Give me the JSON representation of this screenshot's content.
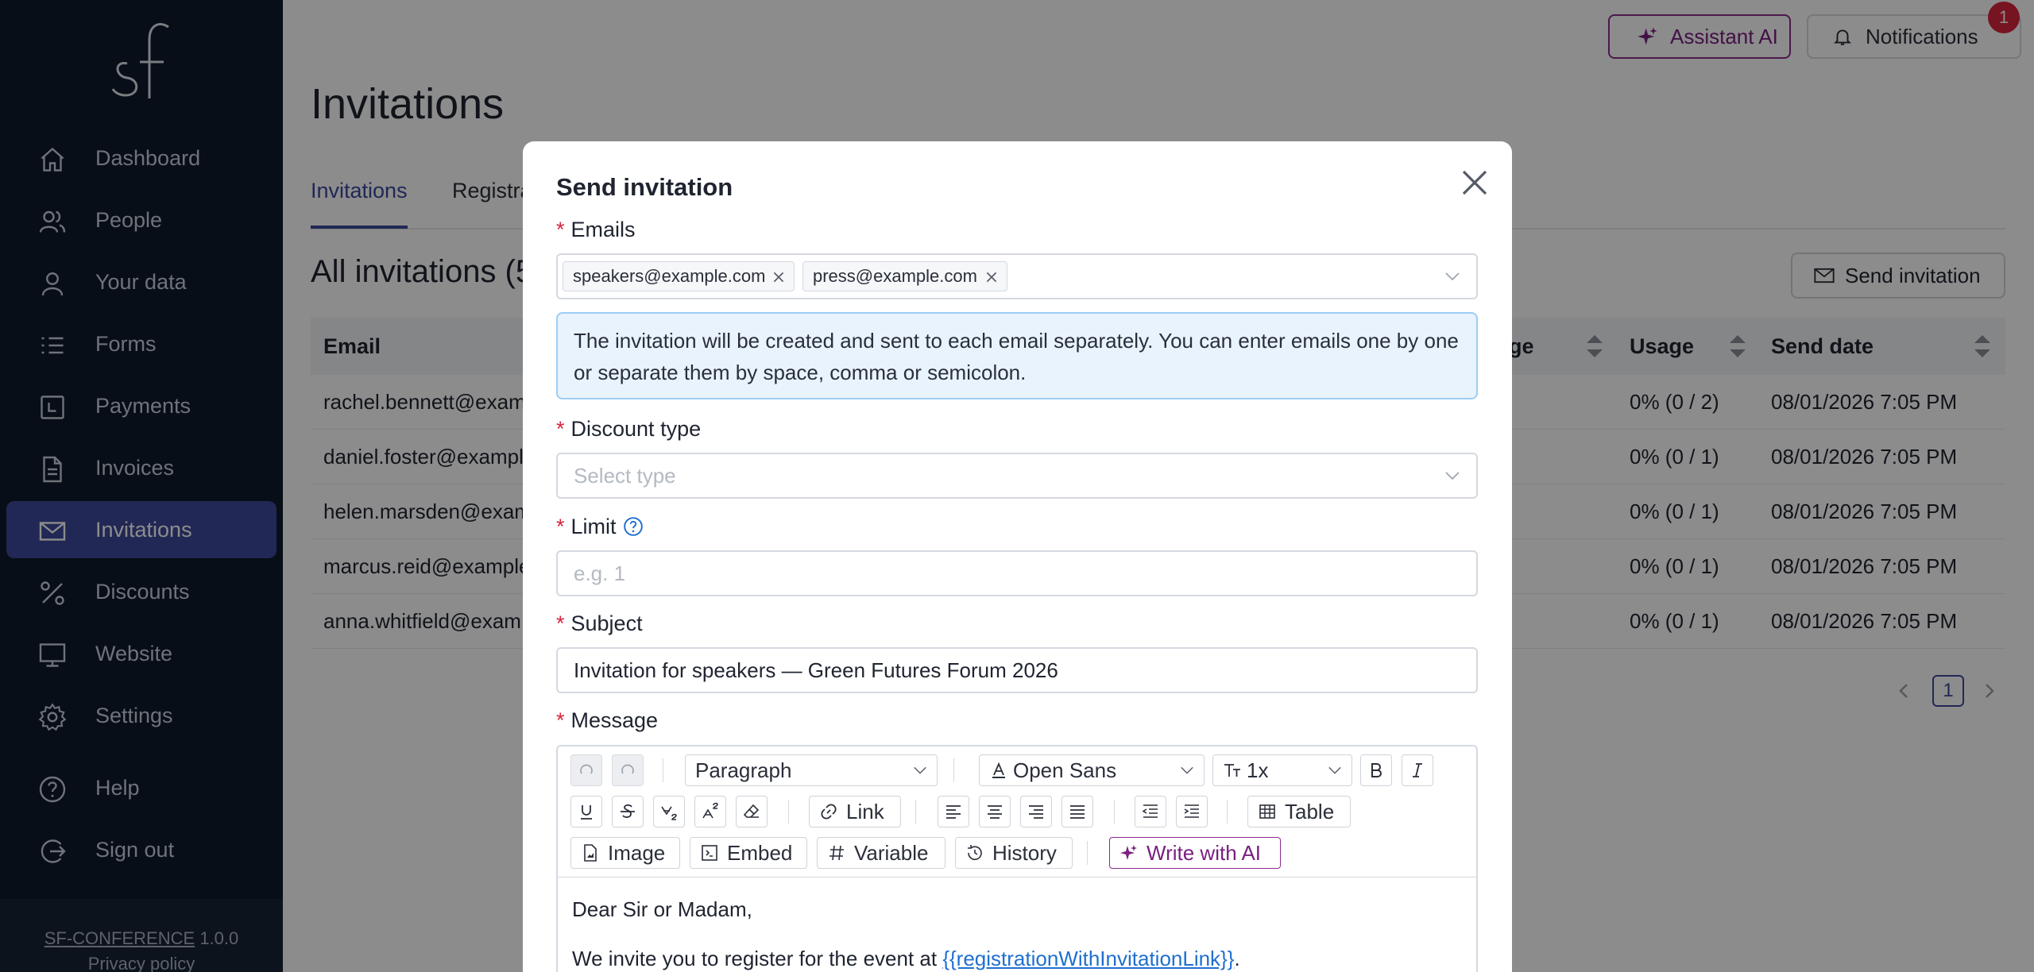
{
  "sidebar": {
    "logo_text": "sf",
    "items": [
      {
        "label": "Dashboard",
        "icon": "home-icon"
      },
      {
        "label": "People",
        "icon": "people-icon"
      },
      {
        "label": "Your data",
        "icon": "user-icon"
      },
      {
        "label": "Forms",
        "icon": "list-icon"
      },
      {
        "label": "Payments",
        "icon": "payment-icon"
      },
      {
        "label": "Invoices",
        "icon": "document-icon"
      },
      {
        "label": "Invitations",
        "icon": "mail-icon",
        "active": true
      },
      {
        "label": "Discounts",
        "icon": "percent-icon"
      },
      {
        "label": "Website",
        "icon": "monitor-icon"
      },
      {
        "label": "Settings",
        "icon": "gear-icon"
      }
    ],
    "bottom_items": [
      {
        "label": "Help",
        "icon": "help-icon"
      },
      {
        "label": "Sign out",
        "icon": "sign-out-icon"
      }
    ],
    "footer_brand": "SF-CONFERENCE",
    "footer_version": "1.0.0",
    "footer_privacy": "Privacy policy"
  },
  "topbar": {
    "assistant_label": "Assistant AI",
    "notifications_label": "Notifications",
    "notifications_count": "1"
  },
  "page": {
    "title": "Invitations",
    "tabs": [
      "Invitations",
      "Registra"
    ],
    "section_title": "All invitations (5",
    "send_invitation_label": "Send invitation",
    "table": {
      "headers": [
        "Email",
        "ge",
        "Usage",
        "Send date"
      ],
      "rows": [
        {
          "email": "rachel.bennett@exam",
          "usage": "0% (0 / 2)",
          "date": "08/01/2026 7:05 PM"
        },
        {
          "email": "daniel.foster@exampl",
          "usage": "0% (0 / 1)",
          "date": "08/01/2026 7:05 PM"
        },
        {
          "email": "helen.marsden@exam",
          "usage": "0% (0 / 1)",
          "date": "08/01/2026 7:05 PM"
        },
        {
          "email": "marcus.reid@example",
          "usage": "0% (0 / 1)",
          "date": "08/01/2026 7:05 PM"
        },
        {
          "email": "anna.whitfield@exam",
          "usage": "0% (0 / 1)",
          "date": "08/01/2026 7:05 PM"
        }
      ]
    },
    "pager_current": "1"
  },
  "modal": {
    "title": "Send invitation",
    "emails_label": "Emails",
    "emails": [
      "speakers@example.com",
      "press@example.com"
    ],
    "info_text": "The invitation will be created and sent to each email separately. You can enter emails one by one or separate them by space, comma or semicolon.",
    "discount_label": "Discount type",
    "discount_placeholder": "Select type",
    "limit_label": "Limit",
    "limit_placeholder": "e.g. 1",
    "subject_label": "Subject",
    "subject_value": "Invitation for speakers — Green Futures Forum 2026",
    "message_label": "Message",
    "toolbar": {
      "block_format": "Paragraph",
      "font_family": "Open Sans",
      "font_size": "1x",
      "link": "Link",
      "table": "Table",
      "image": "Image",
      "embed": "Embed",
      "variable": "Variable",
      "history": "History",
      "write_ai": "Write with AI"
    },
    "body_line1": "Dear Sir or Madam,",
    "body_line2_prefix": "We invite you to register for the event at ",
    "body_line2_link": "{{registrationWithInvitationLink}}",
    "body_line2_suffix": "."
  },
  "colors": {
    "sidebar_bg": "#0d1a2b",
    "active_nav": "#3d4a9c",
    "ai_accent": "#8a2a8f",
    "badge": "#d7263d",
    "info_bg": "#e8f3fd",
    "link": "#1f6fd0"
  }
}
